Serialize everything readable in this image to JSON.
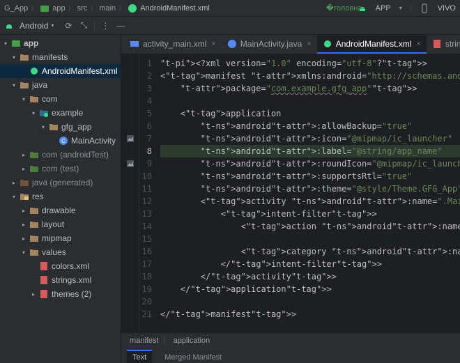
{
  "breadcrumb": {
    "root": "G_App",
    "parts": [
      "app",
      "src",
      "main"
    ],
    "file": "AndroidManifest.xml"
  },
  "runconfig": {
    "label": "APP",
    "device": "VIVO"
  },
  "toolwindow": {
    "selector": "Android"
  },
  "tree": {
    "root": "app",
    "manifests": {
      "label": "manifests",
      "file": "AndroidManifest.xml"
    },
    "java_root": "java",
    "pkg": {
      "com": "com",
      "example": "example",
      "gfg": "gfg_app",
      "activity": "MainActivity"
    },
    "testPkg": "com (androidTest)",
    "unitPkg": "com (test)",
    "gen": "java (generated)",
    "res": {
      "label": "res",
      "drawable": "drawable",
      "layout": "layout",
      "mipmap": "mipmap",
      "values": "values",
      "colors": "colors.xml",
      "strings": "strings.xml",
      "themes": "themes (2)"
    }
  },
  "tabs": [
    {
      "label": "activity_main.xml",
      "type": "layout",
      "closed": false,
      "active": false
    },
    {
      "label": "MainActivity.java",
      "type": "java",
      "closed": false,
      "active": false
    },
    {
      "label": "AndroidManifest.xml",
      "type": "manifest",
      "closed": false,
      "active": true
    },
    {
      "label": "strings.xml",
      "type": "res",
      "closed": true,
      "active": false
    }
  ],
  "code": {
    "lines": [
      "<?xml version=\"1.0\" encoding=\"utf-8\"?>",
      "<manifest xmlns:android=\"http://schemas.android.com/apk/res/android\"",
      "    package=\"com.example.gfg_app\">",
      "",
      "    <application",
      "        android:allowBackup=\"true\"",
      "        android:icon=\"@mipmap/ic_launcher\"",
      "        android:label=\"@string/app_name\"",
      "        android:roundIcon=\"@mipmap/ic_launcher_round\"",
      "        android:supportsRtl=\"true\"",
      "        android:theme=\"@style/Theme.GFG_App\">",
      "        <activity android:name=\".MainActivity\">",
      "            <intent-filter>",
      "                <action android:name=\"android.intent.action.MAIN\" />",
      "",
      "                <category android:name=\"android.intent.category.LAUNCHER",
      "            </intent-filter>",
      "        </activity>",
      "    </application>",
      "",
      "</manifest>"
    ],
    "highlight_line_index": 7,
    "selected_text": "@string/app_name"
  },
  "bottomCrumb": [
    "manifest",
    "application"
  ],
  "bottomTabs": [
    "Text",
    "Merged Manifest"
  ],
  "icons": {
    "run": "run-icon",
    "android": "android-icon",
    "phone": "phone-icon",
    "sync": "sync-icon",
    "collapse": "collapse-icon",
    "more": "more-icon",
    "hide": "hide-icon",
    "image": "image-icon"
  },
  "chart_data": null
}
